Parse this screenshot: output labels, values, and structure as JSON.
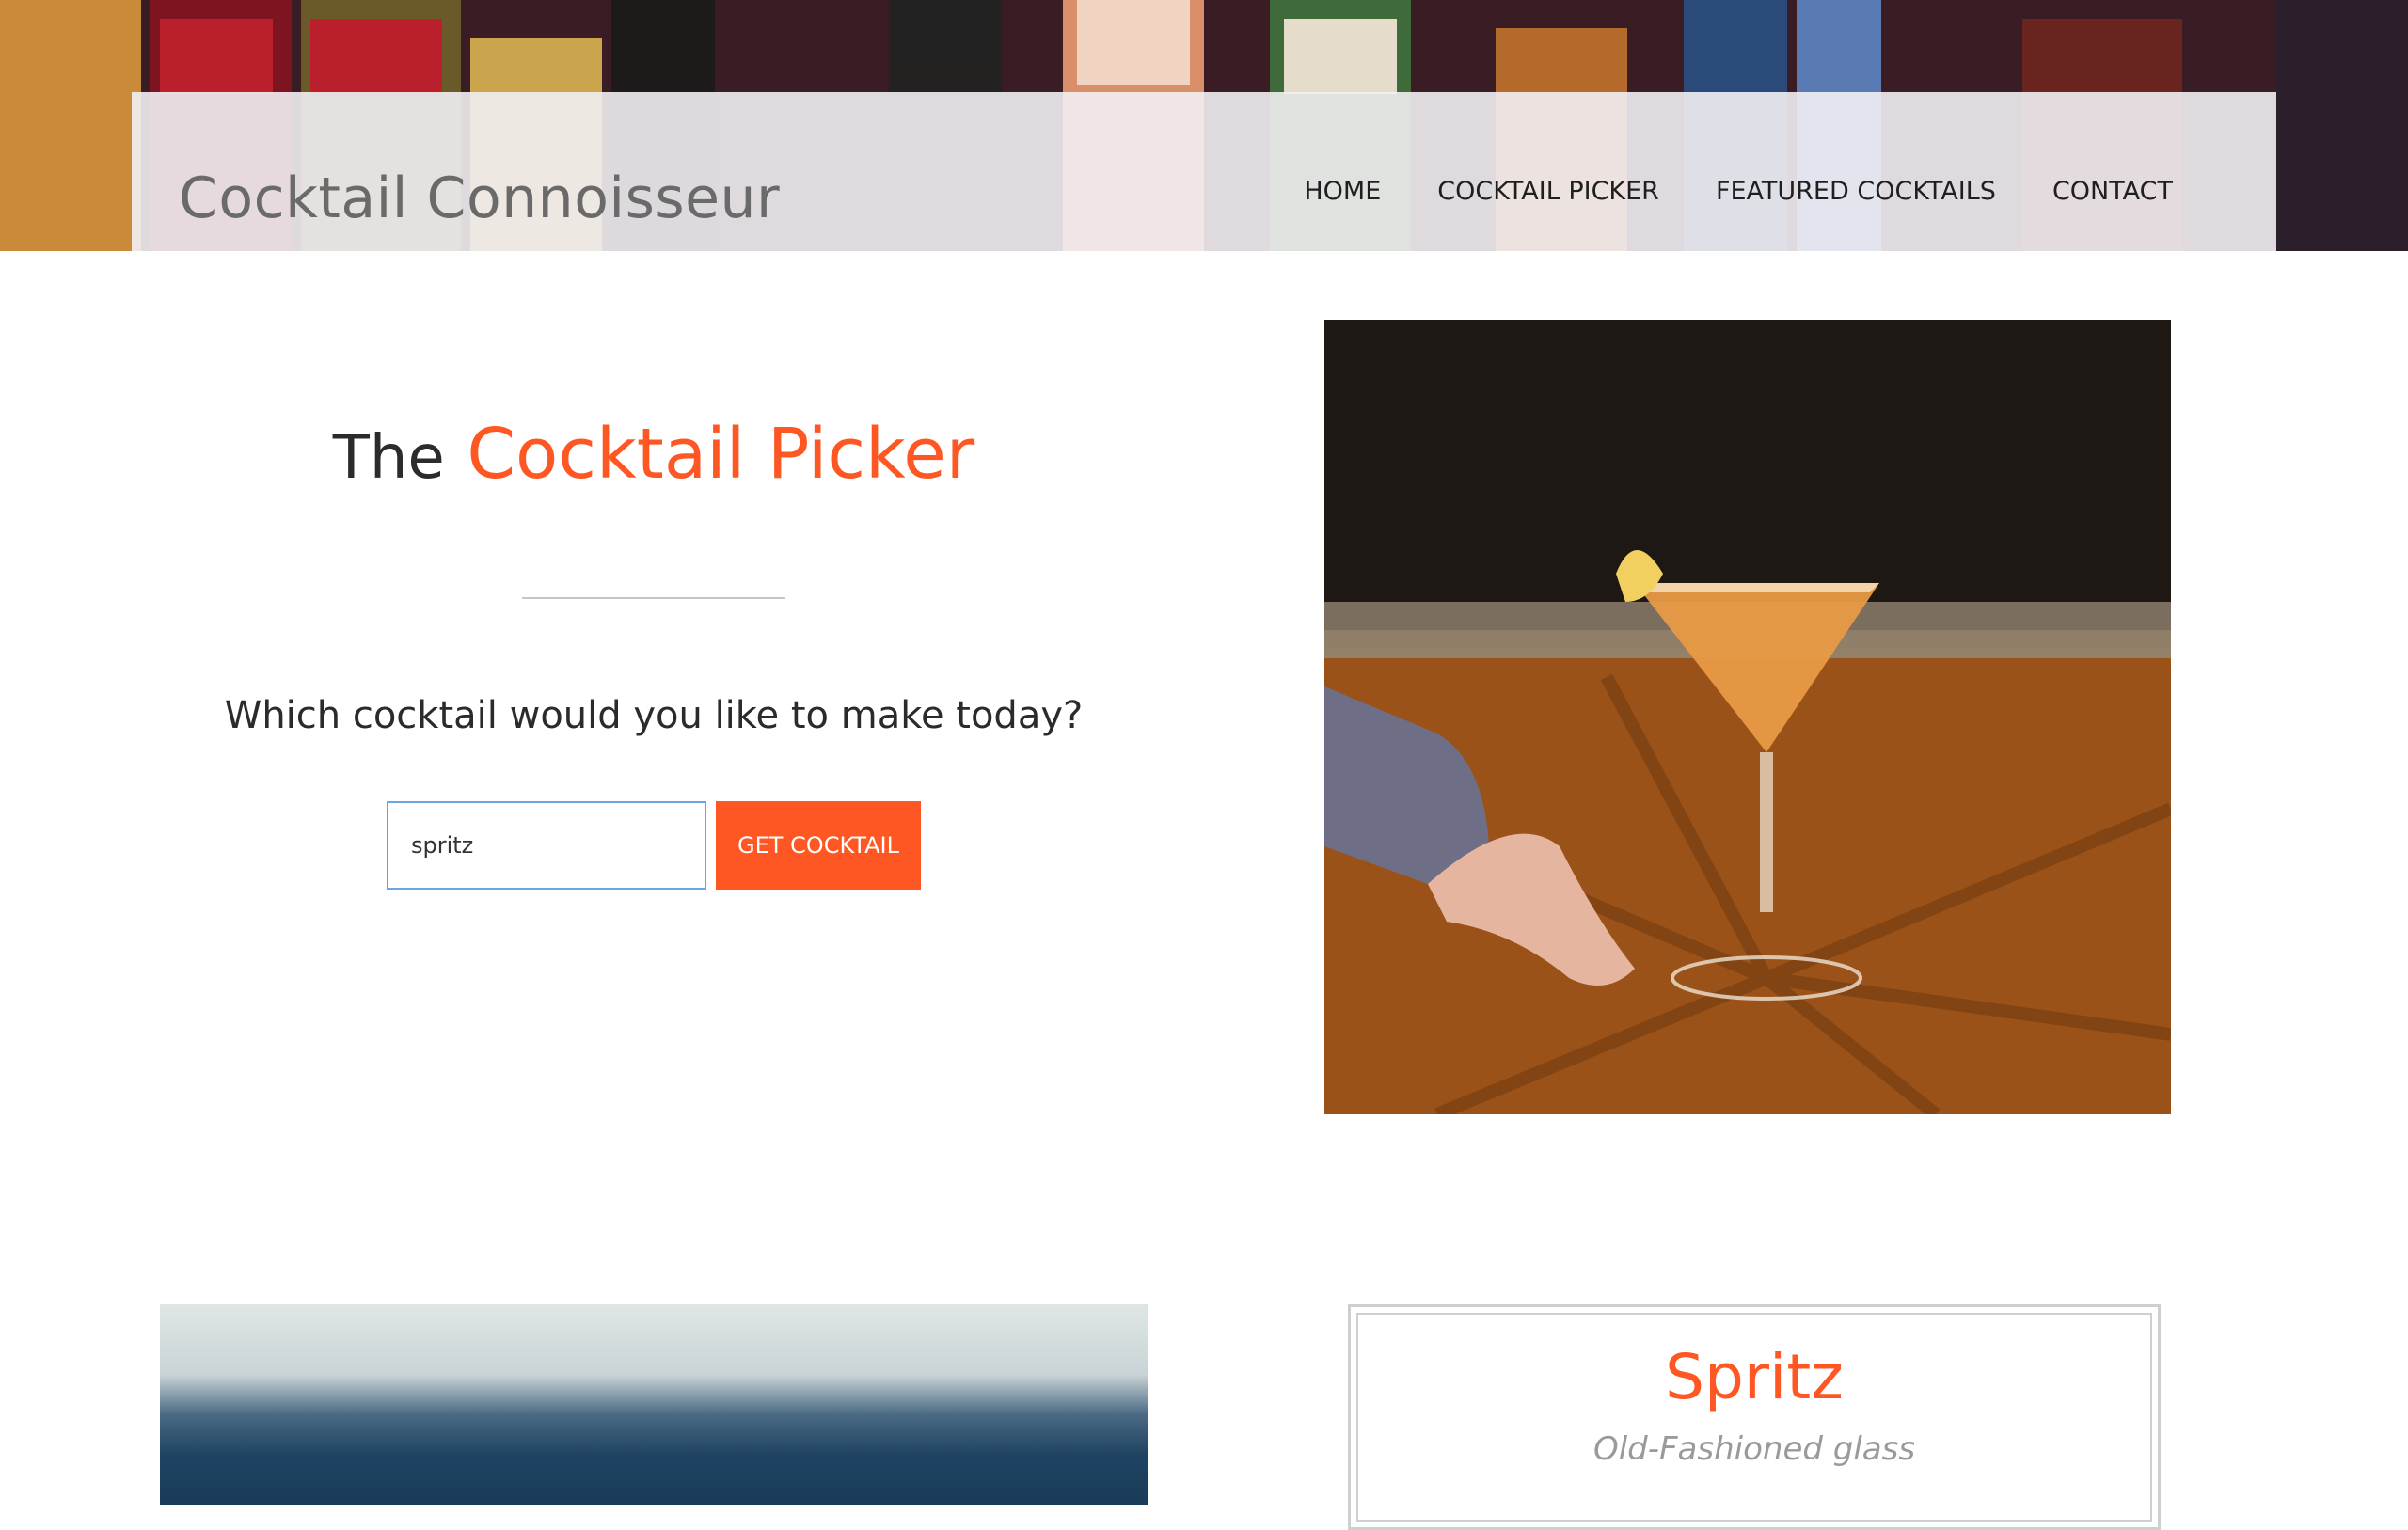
{
  "header": {
    "brand": "Cocktail Connoisseur",
    "nav": [
      "HOME",
      "COCKTAIL PICKER",
      "FEATURED COCKTAILS",
      "CONTACT"
    ]
  },
  "hero": {
    "title_lead": "The",
    "title_accent": "Cocktail Picker",
    "question": "Which cocktail would you like to make today?",
    "search": {
      "value": "spritz",
      "placeholder": ""
    },
    "button_label": "GET COCKTAIL"
  },
  "result": {
    "name": "Spritz",
    "glass": "Old-Fashioned glass"
  },
  "colors": {
    "accent": "#fe5723",
    "nav_bg": "#f2f0f3",
    "input_border": "#6aa6e0"
  }
}
